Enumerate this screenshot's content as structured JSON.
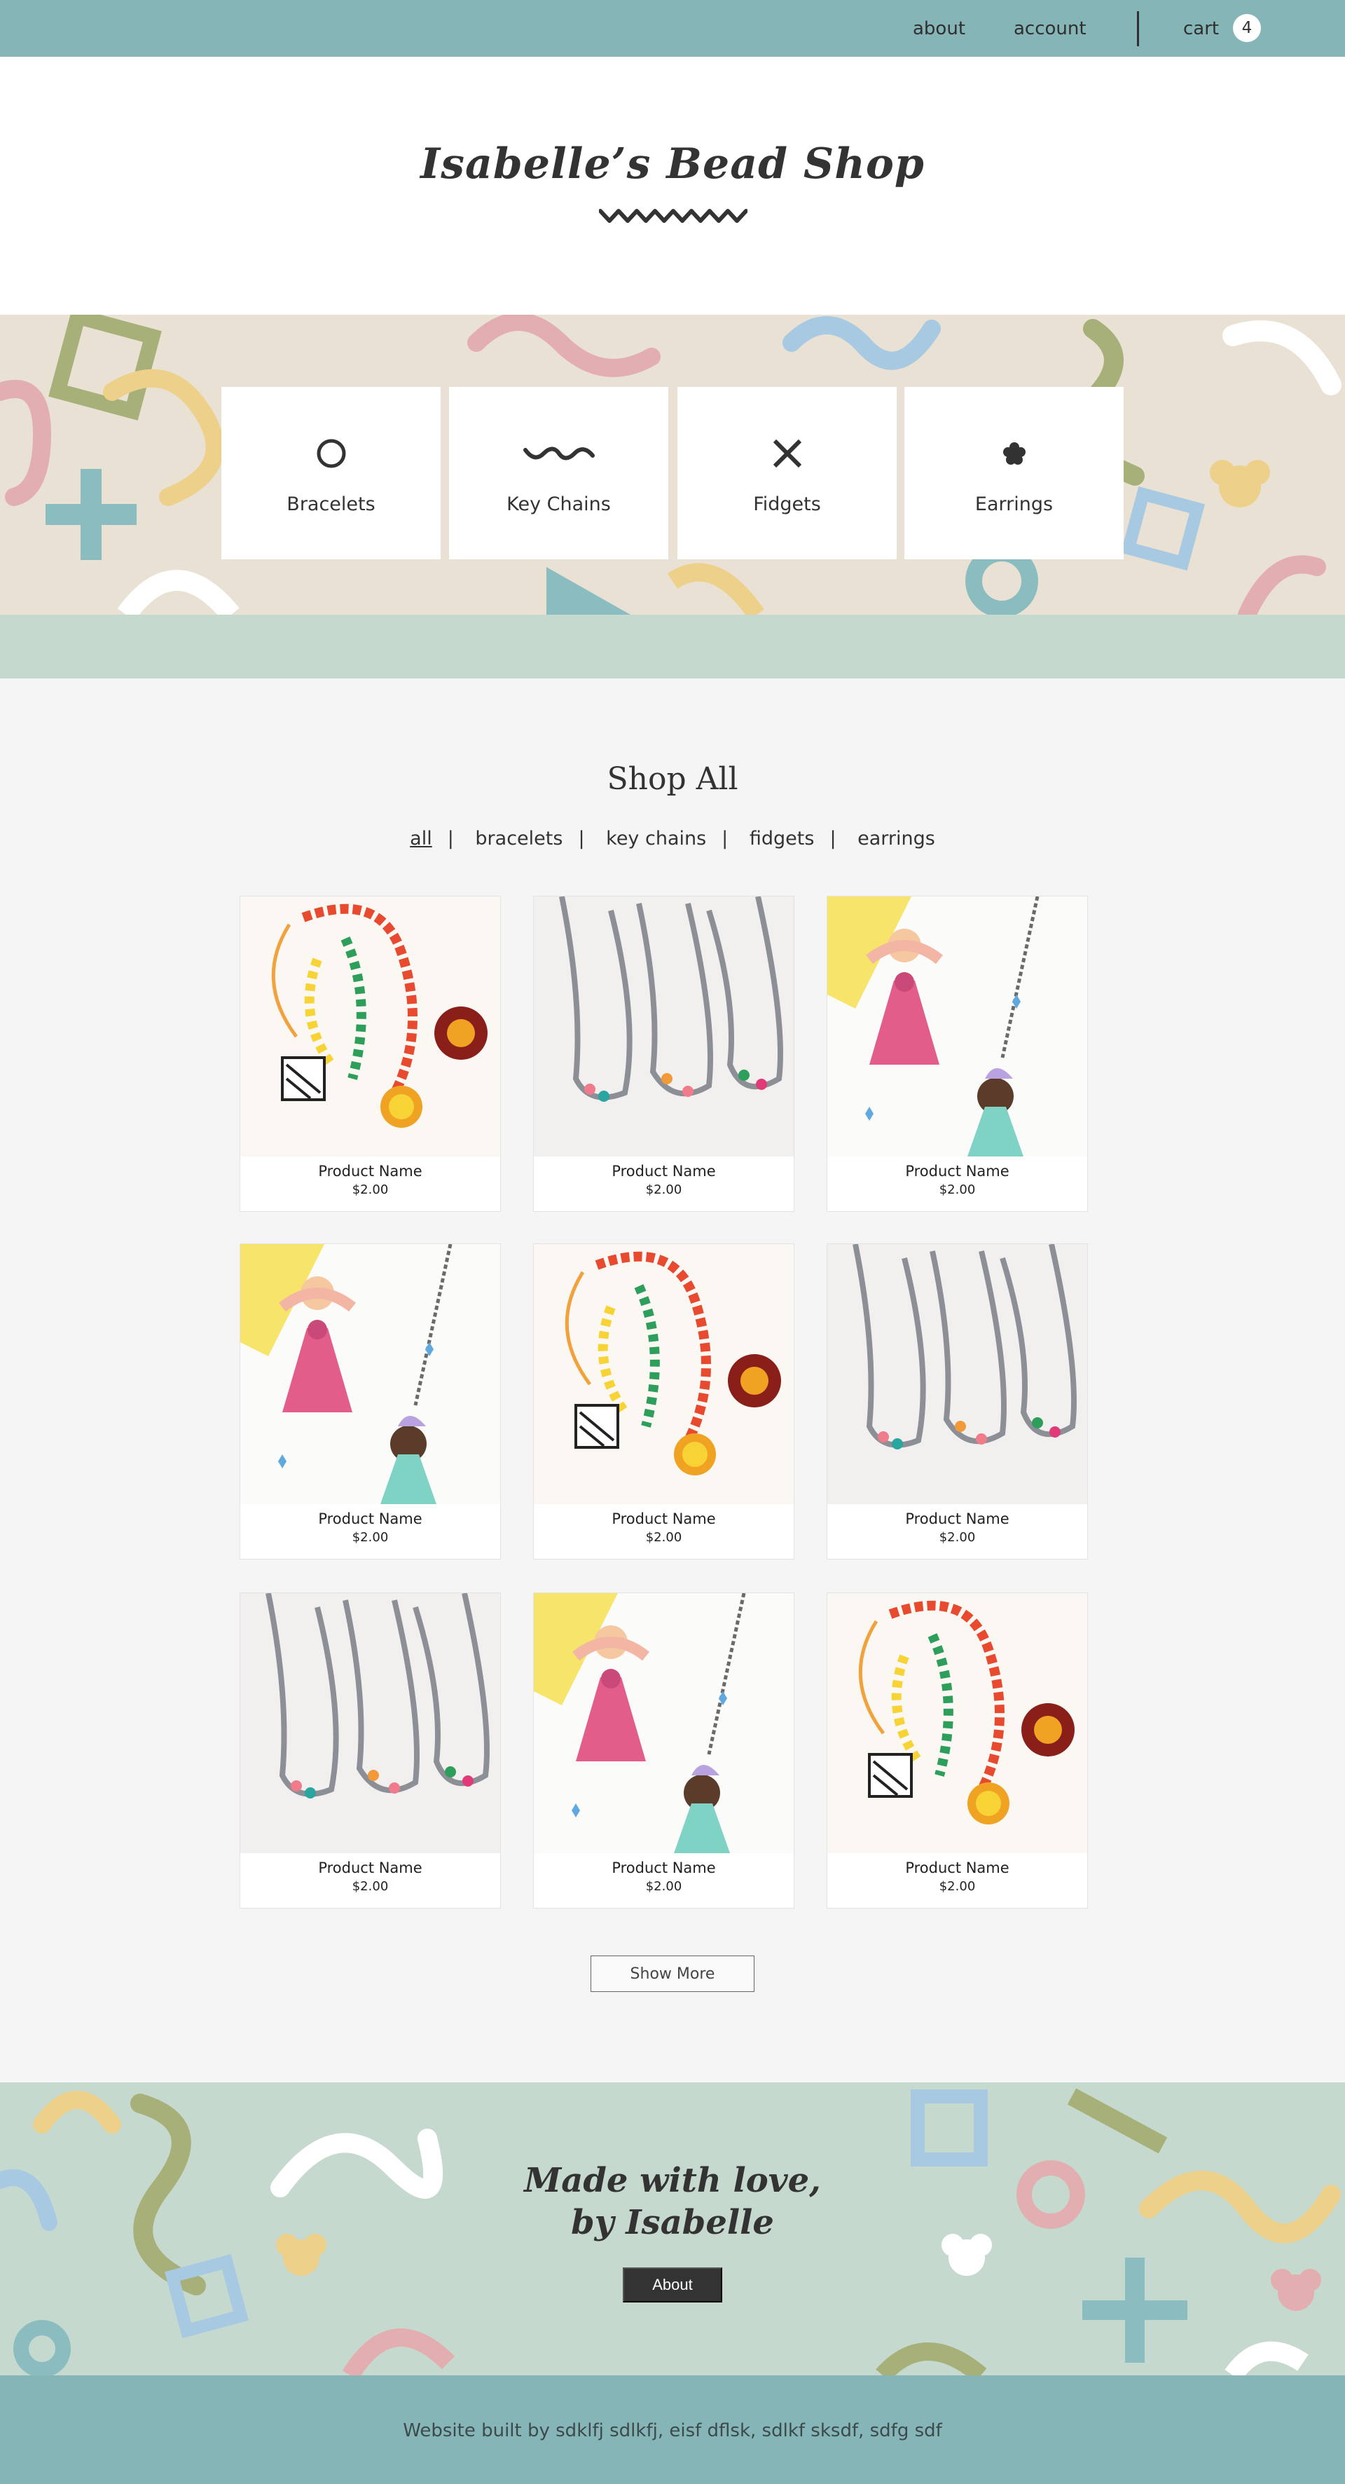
{
  "nav": {
    "about": "about",
    "account": "account",
    "cart": "cart",
    "cart_count": "4"
  },
  "header": {
    "title": "Isabelle’s Bead Shop"
  },
  "categories": [
    {
      "label": "Bracelets",
      "icon": "circle-icon"
    },
    {
      "label": "Key Chains",
      "icon": "wave-icon"
    },
    {
      "label": "Fidgets",
      "icon": "x-icon"
    },
    {
      "label": "Earrings",
      "icon": "flower-icon"
    }
  ],
  "shop": {
    "title": "Shop All",
    "filters": [
      "all",
      "bracelets",
      "key chains",
      "fidgets",
      "earrings"
    ],
    "active_filter": "all",
    "products": [
      {
        "name": "Product Name",
        "price": "$2.00",
        "image": "beaded-necklaces-photo"
      },
      {
        "name": "Product Name",
        "price": "$2.00",
        "image": "yarn-necklaces-photo"
      },
      {
        "name": "Product Name",
        "price": "$2.00",
        "image": "tassel-doll-necklaces-photo"
      },
      {
        "name": "Product Name",
        "price": "$2.00",
        "image": "tassel-doll-necklaces-photo"
      },
      {
        "name": "Product Name",
        "price": "$2.00",
        "image": "beaded-necklaces-photo"
      },
      {
        "name": "Product Name",
        "price": "$2.00",
        "image": "yarn-necklaces-photo"
      },
      {
        "name": "Product Name",
        "price": "$2.00",
        "image": "yarn-necklaces-photo"
      },
      {
        "name": "Product Name",
        "price": "$2.00",
        "image": "tassel-doll-necklaces-photo"
      },
      {
        "name": "Product Name",
        "price": "$2.00",
        "image": "beaded-necklaces-photo"
      }
    ],
    "show_more": "Show More"
  },
  "promo": {
    "line1": "Made with love,",
    "line2": "by Isabelle",
    "button": "About"
  },
  "footer": {
    "text": "Website built by sdklfj sdlkfj, eisf dflsk, sdlkf sksdf, sdfg sdf"
  },
  "colors": {
    "nav_bg": "#86b5b8",
    "band_bg": "#e9e1d3",
    "mint": "#c6d9cf",
    "dark": "#333333"
  }
}
